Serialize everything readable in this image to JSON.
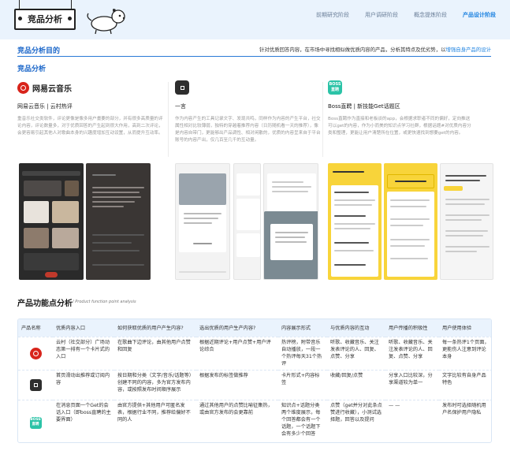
{
  "header": {
    "title": "竞品分析",
    "nav": [
      "前期研究阶段",
      "用户调研阶段",
      "概念提炼阶段",
      "产品设计阶段"
    ],
    "active_index": 3
  },
  "purpose": {
    "label": "竞品分析目的",
    "text_prefix": "针对优质回答内容，在市场中寻找相似做优质内容的产品，分析其特点及优劣势，以",
    "text_highlight": "增强自身产品的设计"
  },
  "section_title": "竞品分析",
  "competitors": [
    {
      "logo_text": "网易云音乐",
      "name": "网易云音乐 | 云村热评",
      "desc": "重音乐社交类软件，评论更像是像多用户畫要的部分，并有很多高质量的评论内容，评论数量多，对于优质回答的产生起到很大作用，高到二次评论，会更容易引起其他人对歌曲本身的兴趣度增加互动设置，从而提升互动率。"
    },
    {
      "logo_text": "一言",
      "name": "一言",
      "desc": "作为内容产生的工具记录文字、发现共鸣，同样作为内容的产生平台，社交属性相对比较薄弱，独特的穿越着推荐内容（日历随机看一天的推荐），像是内容自带门，更能够出产品调性、相对闲散的，优质的内容呈来自于平台账号的内容产出，仅几百至几千的互动量。"
    },
    {
      "logo_text": "BOSS\n直聘",
      "name": "Boss直聘 | 新技能Get话题区",
      "desc": "Boss直聘作为直接和老板谈的app，会根据求职者不同的偏好，定向推送可以get的内容，作为小而美的知识点学习社群，根据话题#对优质内容分类和整理，更能让用户清楚所在位置，或更快速找到想要get的内容。"
    }
  ],
  "analysis": {
    "title": "产品功能点分析",
    "subtitle": "/ Product function point analysis",
    "headers": [
      "产品名称",
      "优质内容入口",
      "如何获取优质的用户产生内容?",
      "选出优质的用户生产内容?",
      "内容展示形式",
      "与优质内容的互动",
      "用户传播的积极性",
      "用户使用体验"
    ],
    "rows": [
      {
        "icon": "netease-music-icon",
        "cells": [
          "云村（社交部分）广场动态第一排有一个卡片式的入口",
          "在歌曲下边评论，由其他用户点赞和回复",
          "根据近期评论+用户点赞+用户评论综合",
          "热评榜，附带音乐自动播放，一段一个热评每天31个热评",
          "听歌、收藏音乐、关注发表评论的人、回复、点赞、分享",
          "听歌、收藏音乐、关注发表评论的人、回复、点赞、分享",
          "每一条热评1个页面，更能伤人注意到评论本身"
        ]
      },
      {
        "icon": "yiyan-icon",
        "cells": [
          "首页滑动出推荐或订阅内容",
          "按日期和分类（文字/音乐/话题等）创建不同的内容，多为官方发布内容，或按照发布时间顺序展示",
          "根据发布的标签做推荐",
          "卡片形式+内容标签",
          "收藏/回复/点赞",
          "分享入口比较深，分享渠道较为单一",
          "文字比较有自身产品特色"
        ]
      },
      {
        "icon": "boss-zhipin-icon",
        "cells": [
          "在消息页面一个Get的会话入口（即boss直聘的主要界面）",
          "由官方提供+其他用户可匿名发表，根据行业不同，推荐给偏好不同的人",
          "通过其他用户的点赞比喻征集热，或由官方发布的会更靠前",
          "知识点+话题分类两个维度展示，每个回答都会有一个话题，一个话题下会有多少个回答",
          "点赞（get并分对此条点赞进行收藏），小测试选择题，回答以及提问",
          "— —",
          "发布时可选择随机用户名保护用户隐私"
        ]
      }
    ]
  },
  "colors": {
    "accent": "#1a80e0",
    "header_bg": "#eaf3fd",
    "netease_red": "#d8241b",
    "boss_green": "#2bc3a7"
  }
}
